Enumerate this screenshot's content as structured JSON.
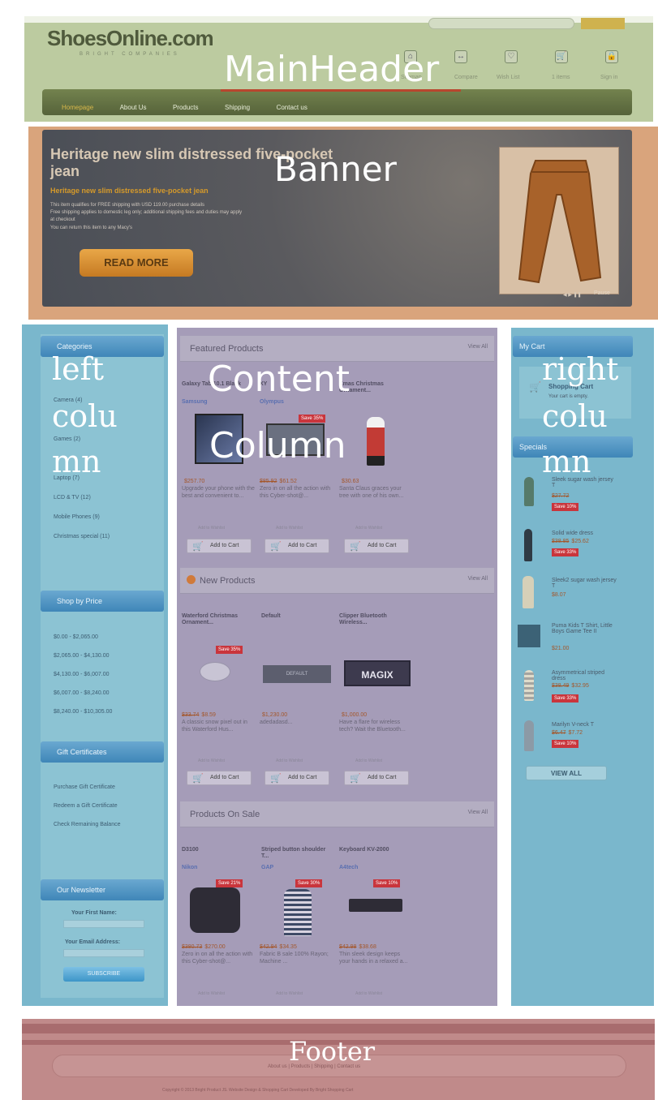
{
  "header": {
    "logo": "ShoesOnline.com",
    "tagline": "BRIGHT COMPANIES",
    "label": "MainHeader",
    "icon_labels": [
      "Sitemap",
      "Compare",
      "Wish List",
      "1 items",
      "Sign in"
    ],
    "nav": [
      "Homepage",
      "About Us",
      "Products",
      "Shipping",
      "Contact us"
    ]
  },
  "banner": {
    "label": "Banner",
    "title": "Heritage new slim distressed five-pocket jean",
    "subtitle": "Heritage new slim distressed five-pocket jean",
    "body_lines": [
      "This item qualifies for FREE shipping with USD 119.00 purchase details",
      "Free shipping applies to domestic leg only; additional shipping fees and duties may apply",
      "at checkout",
      "You can return this item to any Macy's"
    ],
    "button": "READ MORE",
    "pager": "Pause"
  },
  "left_column": {
    "label_lines": [
      "left",
      "colu",
      "mn"
    ],
    "categories_title": "Categories",
    "categories": [
      "Camera (4)",
      "Games (2)",
      "Laptop (7)",
      "LCD & TV (12)",
      "Mobile Phones (9)",
      "Christmas special (11)"
    ],
    "price_title": "Shop by Price",
    "price_ranges": [
      "$0.00 - $2,065.00",
      "$2,065.00 - $4,130.00",
      "$4,130.00 - $6,007.00",
      "$6,007.00 - $8,240.00",
      "$8,240.00 - $10,305.00"
    ],
    "gift_title": "Gift Certificates",
    "gift_links": [
      "Purchase Gift Certificate",
      "Redeem a Gift Certificate",
      "Check Remaining Balance"
    ],
    "newsletter_title": "Our Newsletter",
    "first_name": "Your First Name:",
    "email": "Your Email Address:",
    "subscribe": "SUBSCRIBE"
  },
  "content": {
    "label_lines": [
      "Content",
      "Column"
    ],
    "view_all": "View All",
    "add_to_cart": "Add to Cart",
    "wishlist": "Add to Wishlist",
    "featured": {
      "title": "Featured Products",
      "products": [
        {
          "name": "Galaxy Tab 10.1 Black",
          "brand": "Samsung",
          "old": "",
          "price": "$257.70",
          "desc": "Upgrade your phone with the best and convenient to...",
          "save": ""
        },
        {
          "name": "XY",
          "brand": "Olympus",
          "old": "$85.92",
          "price": "$61.52",
          "desc": "Zero in on all the action with this Cyber-shot@...",
          "save": "Save 35%"
        },
        {
          "name": "Xmas Christmas Ornament...",
          "brand": "",
          "old": "",
          "price": "$30.63",
          "desc": "Santa Claus graces your tree with one of his own...",
          "save": ""
        }
      ]
    },
    "new": {
      "title": "New Products",
      "products": [
        {
          "name": "Waterford Christmas Ornament...",
          "brand": "",
          "old": "$33.74",
          "price": "$8.59",
          "desc": "A classic snow pixel out in this Waterford Hus...",
          "save": "Save 35%",
          "img": ""
        },
        {
          "name": "Default",
          "brand": "",
          "old": "",
          "price": "$1,230.00",
          "desc": "adedadasd...",
          "save": "",
          "img": "DEFAULT"
        },
        {
          "name": "Clipper Bluetooth Wireless...",
          "brand": "",
          "old": "",
          "price": "$1,000.00",
          "desc": "Have a flare for wireless tech? Wait the Bluetooth...",
          "save": "",
          "img": "MAGIX"
        }
      ]
    },
    "sale": {
      "title": "Products On Sale",
      "products": [
        {
          "name": "D3100",
          "brand": "Nikon",
          "old": "$380.73",
          "price": "$270.00",
          "desc": "Zero in on all the action with this Cyber-shot@...",
          "save": "Save 21%"
        },
        {
          "name": "Striped button shoulder T...",
          "brand": "GAP",
          "old": "$42.94",
          "price": "$34.35",
          "desc": "Fabric B sale 100% Rayon; Machine ...",
          "save": "Save 30%"
        },
        {
          "name": "Keyboard KV-2000",
          "brand": "A4tech",
          "old": "$42.98",
          "price": "$38.68",
          "desc": "Thin sleek design keeps your hands in a relaxed a...",
          "save": "Save 10%"
        }
      ]
    }
  },
  "right_column": {
    "label_lines": [
      "right",
      "colu",
      "mn"
    ],
    "cart_title": "My Cart",
    "cart_link": "Shopping Cart",
    "cart_empty": "Your cart is empty.",
    "specials_title": "Specials",
    "specials": [
      {
        "name": "Sleek sugar wash jersey T",
        "old": "$27.72",
        "price": "$27.72",
        "save": "Save 10%"
      },
      {
        "name": "Solid wide dress",
        "old": "$38.85",
        "price": "$25.62",
        "save": "Save 33%"
      },
      {
        "name": "Sleek2 sugar wash jersey T",
        "old": "",
        "price": "$8.07",
        "save": ""
      },
      {
        "name": "Puma Kids T Shirt, Little Boys Game Tee II",
        "old": "",
        "price": "$21.00",
        "save": ""
      },
      {
        "name": "Asymmetrical striped dress",
        "old": "$38.49",
        "price": "$32.95",
        "save": "Save 33%"
      },
      {
        "name": "Marilyn V-neck T",
        "old": "$6.47",
        "price": "$7.72",
        "save": "Save 10%"
      }
    ],
    "view_all": "VIEW ALL"
  },
  "footer": {
    "label": "Footer",
    "links": "About us | Products | Shipping | Contact us",
    "copyright": "Copyright © 2013 Bright Product JS. Website Design & Shopping Cart Developed By Bright Shopping Cart"
  },
  "colors": {
    "header_overlay": "#b7c89a",
    "banner_overlay": "#d9a47c",
    "left_overlay": "#7ab7cc",
    "content_overlay": "#a59cb8",
    "right_overlay": "#7ab7cc",
    "footer_overlay": "#c08a8a"
  }
}
